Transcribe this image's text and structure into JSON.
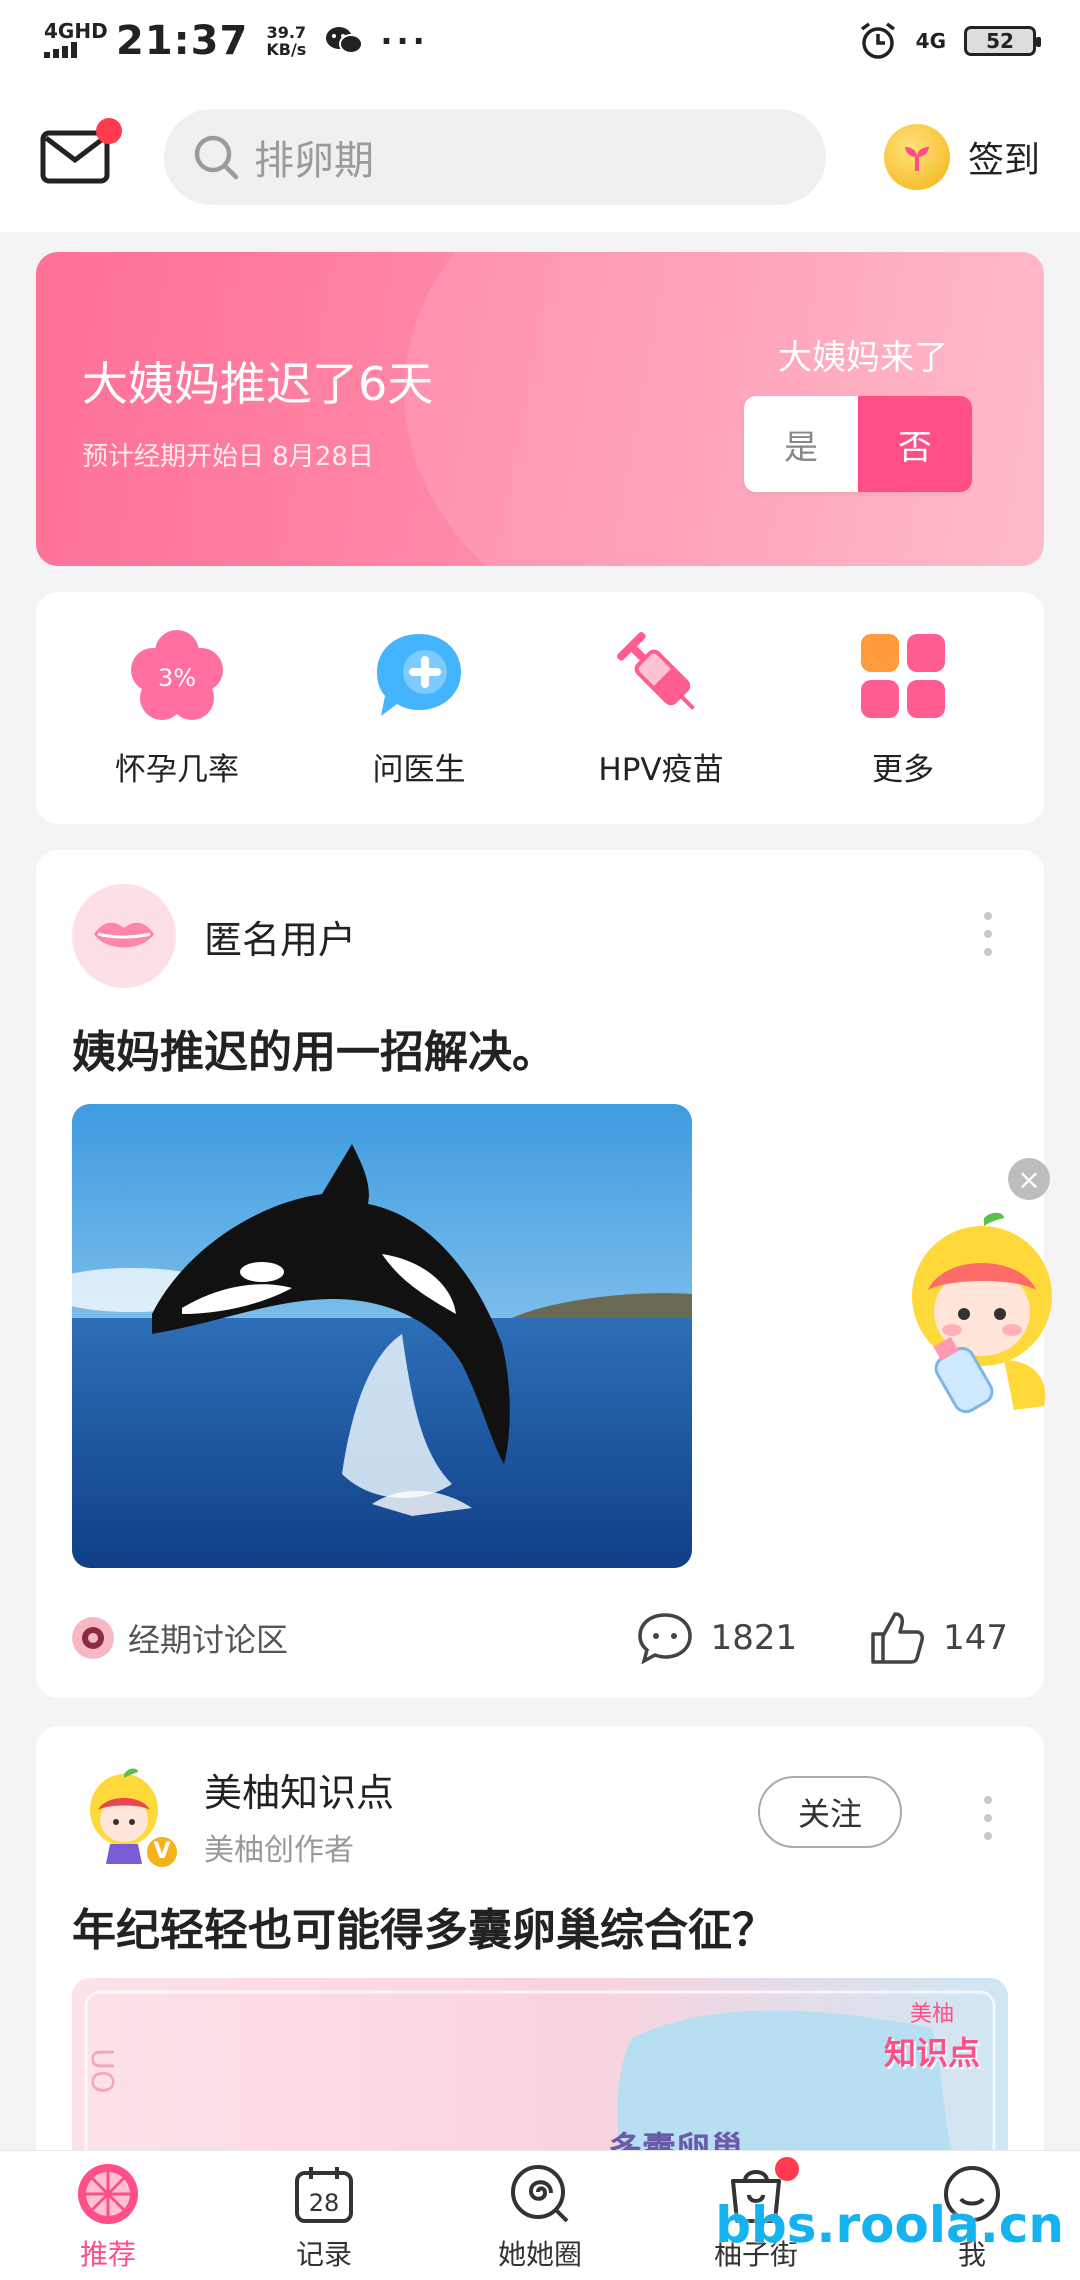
{
  "status_bar": {
    "network": "4GHD",
    "time": "21:37",
    "speed_value": "39.7",
    "speed_unit": "KB/s",
    "dots": "···",
    "net_right": "4G",
    "battery": "52"
  },
  "header": {
    "search_placeholder": "排卵期",
    "signin_label": "签到",
    "icons": [
      "mail-icon",
      "search-icon",
      "coin-icon"
    ]
  },
  "period_banner": {
    "title": "大姨妈推迟了6天",
    "subtitle": "预计经期开始日 8月28日",
    "question": "大姨妈来了",
    "yes_label": "是",
    "no_label": "否",
    "colors": {
      "start": "#ff6f96",
      "end": "#ffb3c2",
      "no_button": "#ff4f86"
    }
  },
  "tools": [
    {
      "label": "怀孕几率",
      "icon": "flower-percent-icon",
      "badge": "3%"
    },
    {
      "label": "问医生",
      "icon": "doctor-chat-icon"
    },
    {
      "label": "HPV疫苗",
      "icon": "syringe-icon"
    },
    {
      "label": "更多",
      "icon": "grid-more-icon"
    }
  ],
  "posts": [
    {
      "user": "匿名用户",
      "title": "姨妈推迟的用一招解决。",
      "image": "orca-jumping-image",
      "forum": "经期讨论区",
      "comments": "1821",
      "likes": "147"
    },
    {
      "user": "美柚知识点",
      "role": "美柚创作者",
      "follow_label": "关注",
      "badge": "V",
      "title": "年纪轻轻也可能得多囊卵巢综合征？",
      "image_caption": "多囊卵巢",
      "logo_top": "美柚",
      "logo_bottom": "知识点"
    }
  ],
  "tabbar": {
    "tabs": [
      {
        "label": "推荐",
        "icon": "grapefruit-icon",
        "active": true
      },
      {
        "label": "记录",
        "icon": "calendar-icon",
        "day": "28"
      },
      {
        "label": "她她圈",
        "icon": "swirl-icon"
      },
      {
        "label": "柚子街",
        "icon": "bag-icon"
      },
      {
        "label": "我",
        "icon": "profile-icon"
      }
    ]
  },
  "watermark": "bbs.roola.cn"
}
